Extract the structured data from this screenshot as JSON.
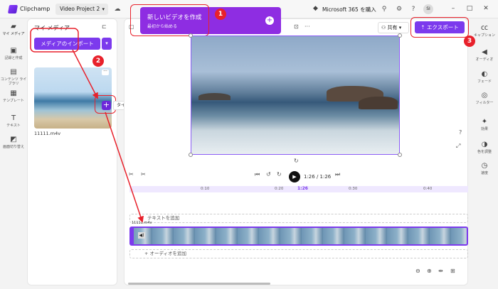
{
  "app": {
    "name": "Clipchamp",
    "project": "Video Project 2",
    "m365": "Microsoft 365 を購入",
    "user_initials": "SI"
  },
  "left_rail": [
    {
      "label": "マイ メディア",
      "icon": "folder-icon"
    },
    {
      "label": "記録と作成",
      "icon": "camera-icon"
    },
    {
      "label": "コンテンツ ライブラリ",
      "icon": "library-icon"
    },
    {
      "label": "テンプレート",
      "icon": "template-icon"
    },
    {
      "label": "テキスト",
      "icon": "text-icon"
    },
    {
      "label": "画面切り替え",
      "icon": "transition-icon"
    }
  ],
  "media": {
    "title": "マイ メディア",
    "import_label": "メディアのインポート",
    "file_name": "11111.m4v",
    "add_tooltip": "タイムラインに追加"
  },
  "create": {
    "title": "新しいビデオを作成",
    "subtitle": "最初から始める"
  },
  "toolbar": {
    "share_label": "共有",
    "export_label": "エクスポート"
  },
  "player": {
    "time": "1:26 / 1:26"
  },
  "timeline": {
    "ticks": [
      "0:10",
      "0:20",
      "1:26",
      "0:30",
      "0:40"
    ],
    "text_track": "テキストを追加",
    "clip_name": "11111.m4v",
    "audio_track": "+ オーディオを追加"
  },
  "right_rail": [
    {
      "label": "キャプション",
      "icon": "captions-icon"
    },
    {
      "label": "オーディオ",
      "icon": "audio-icon"
    },
    {
      "label": "フェード",
      "icon": "fade-icon"
    },
    {
      "label": "フィルター",
      "icon": "filter-icon"
    },
    {
      "label": "効果",
      "icon": "effects-icon"
    },
    {
      "label": "色を調整",
      "icon": "color-icon"
    },
    {
      "label": "速度",
      "icon": "speed-icon"
    }
  ],
  "badges": [
    "1",
    "2",
    "3"
  ],
  "colors": {
    "accent": "#7c3aed",
    "annotation": "#e8212b",
    "create": "#8e2de2"
  }
}
